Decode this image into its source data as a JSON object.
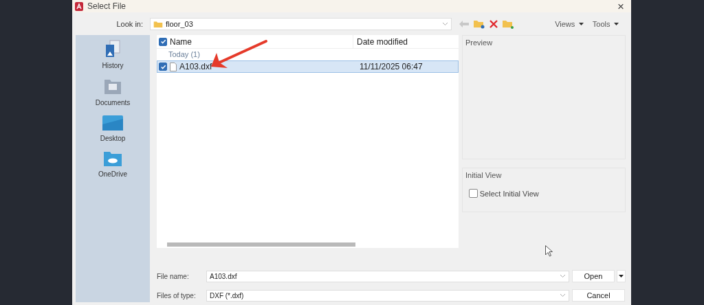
{
  "window": {
    "title": "Select File",
    "close": "×"
  },
  "look_in": {
    "label": "Look in:",
    "value": "floor_03"
  },
  "toolbar": {
    "back_disabled": true,
    "menus": [
      {
        "label": "Views"
      },
      {
        "label": "Tools"
      }
    ]
  },
  "sidebar": {
    "items": [
      {
        "label": "History",
        "kind": "history"
      },
      {
        "label": "Documents",
        "kind": "documents"
      },
      {
        "label": "Desktop",
        "kind": "desktop"
      },
      {
        "label": "OneDrive",
        "kind": "cloud"
      }
    ]
  },
  "file_list": {
    "header_checked": true,
    "columns": [
      "Name",
      "Date modified"
    ],
    "groups": [
      {
        "label": "Today (1)",
        "rows": [
          {
            "name": "A103.dxf",
            "date": "11/11/2025 06:47",
            "selected": true,
            "checked": true
          }
        ]
      }
    ]
  },
  "preview": {
    "label": "Preview"
  },
  "initial_view": {
    "label": "Initial View",
    "checkbox": {
      "label": "Select Initial View",
      "checked": false
    }
  },
  "file_name": {
    "label": "File name:",
    "value": "A103.dxf"
  },
  "files_of_type": {
    "label": "Files of type:",
    "value": "DXF (*.dxf)"
  },
  "buttons": [
    {
      "label": "Open",
      "kind": "split"
    },
    {
      "label": "Cancel",
      "kind": "plain"
    }
  ]
}
